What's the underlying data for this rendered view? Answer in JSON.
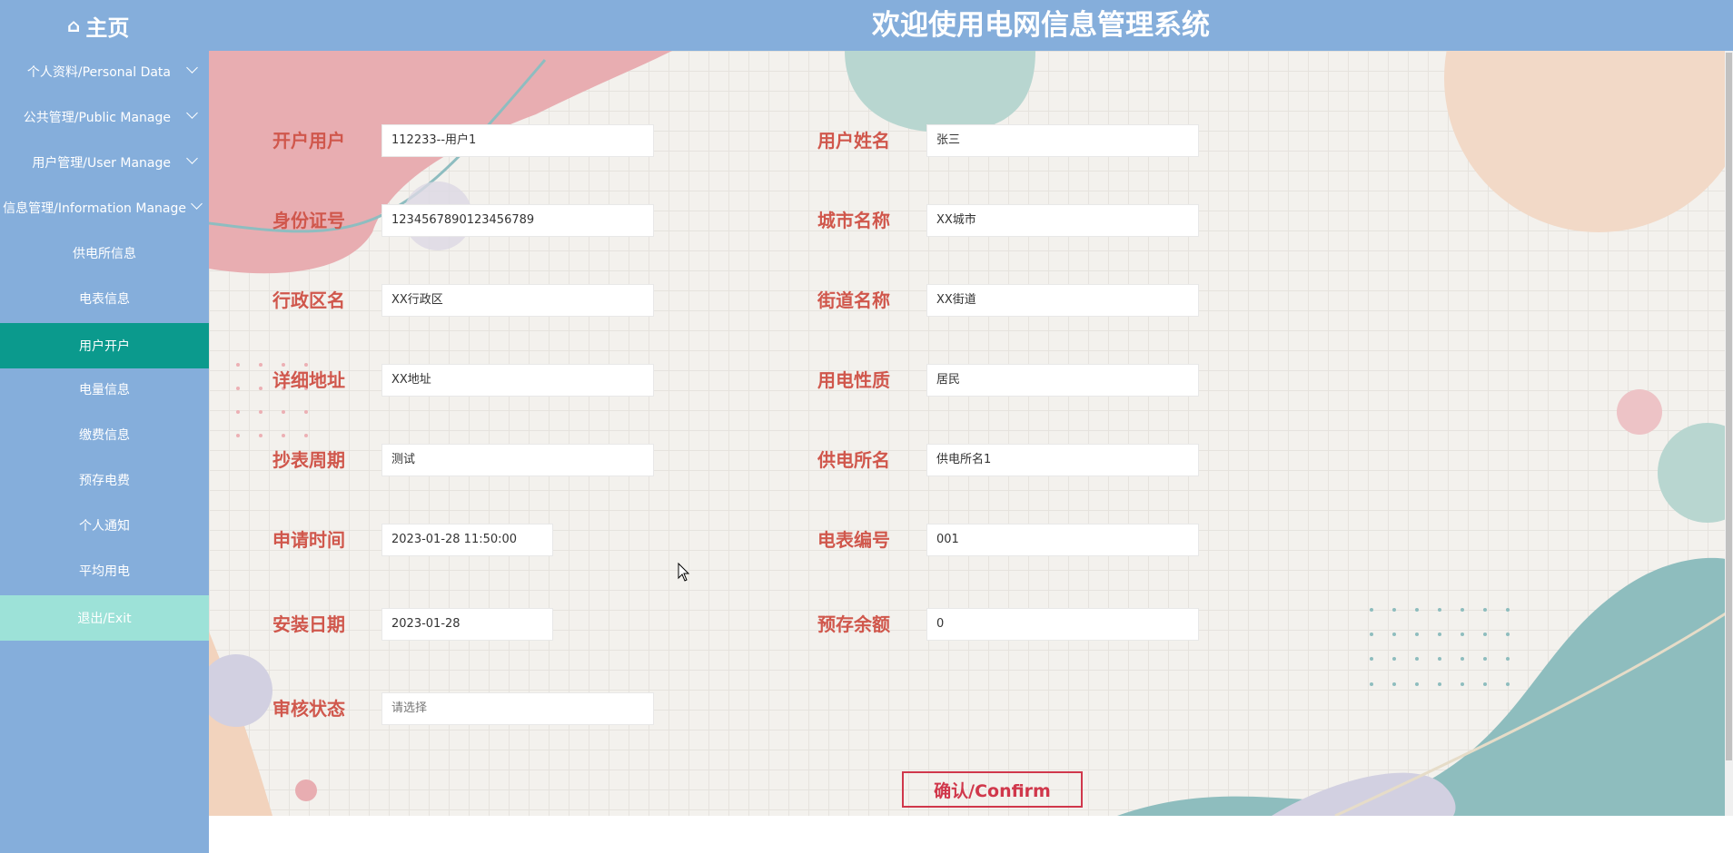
{
  "header": {
    "home_label": "主页",
    "home_icon": "home-icon",
    "title": "欢迎使用电网信息管理系统",
    "background_color": "#85aedb"
  },
  "sidebar": {
    "items": [
      {
        "label": "个人资料/Personal Data",
        "type": "group"
      },
      {
        "label": "公共管理/Public Manage",
        "type": "group"
      },
      {
        "label": "用户管理/User Manage",
        "type": "group"
      },
      {
        "label": "信息管理/Information Manage",
        "type": "group"
      },
      {
        "label": "供电所信息",
        "type": "item"
      },
      {
        "label": "电表信息",
        "type": "item"
      },
      {
        "label": "用户开户",
        "type": "item",
        "active": true
      },
      {
        "label": "电量信息",
        "type": "item"
      },
      {
        "label": "缴费信息",
        "type": "item"
      },
      {
        "label": "预存电费",
        "type": "item"
      },
      {
        "label": "个人通知",
        "type": "item"
      },
      {
        "label": "平均用电",
        "type": "item"
      },
      {
        "label": "退出/Exit",
        "type": "exit"
      }
    ],
    "active_color": "#0b9a8d",
    "exit_color": "#9de2d8"
  },
  "form": {
    "fields": {
      "open_user": {
        "label": "开户用户",
        "value": "112233--用户1"
      },
      "user_name": {
        "label": "用户姓名",
        "value": "张三"
      },
      "id_number": {
        "label": "身份证号",
        "value": "1234567890123456789"
      },
      "city_name": {
        "label": "城市名称",
        "value": "XX城市"
      },
      "district_name": {
        "label": "行政区名",
        "value": "XX行政区"
      },
      "street_name": {
        "label": "街道名称",
        "value": "XX街道"
      },
      "address": {
        "label": "详细地址",
        "value": "XX地址"
      },
      "power_usage_type": {
        "label": "用电性质",
        "value": "居民"
      },
      "meter_cycle": {
        "label": "抄表周期",
        "value": "测试"
      },
      "power_station": {
        "label": "供电所名",
        "value": "供电所名1"
      },
      "apply_time": {
        "label": "申请时间",
        "value": "2023-01-28 11:50:00"
      },
      "meter_number": {
        "label": "电表编号",
        "value": "001"
      },
      "install_date": {
        "label": "安装日期",
        "value": "2023-01-28"
      },
      "prepaid_balance": {
        "label": "预存余额",
        "value": "0"
      },
      "review_status": {
        "label": "审核状态",
        "placeholder": "请选择"
      }
    },
    "confirm_label": "确认/Confirm",
    "label_color": "#d0574c",
    "confirm_color": "#d0374b"
  }
}
